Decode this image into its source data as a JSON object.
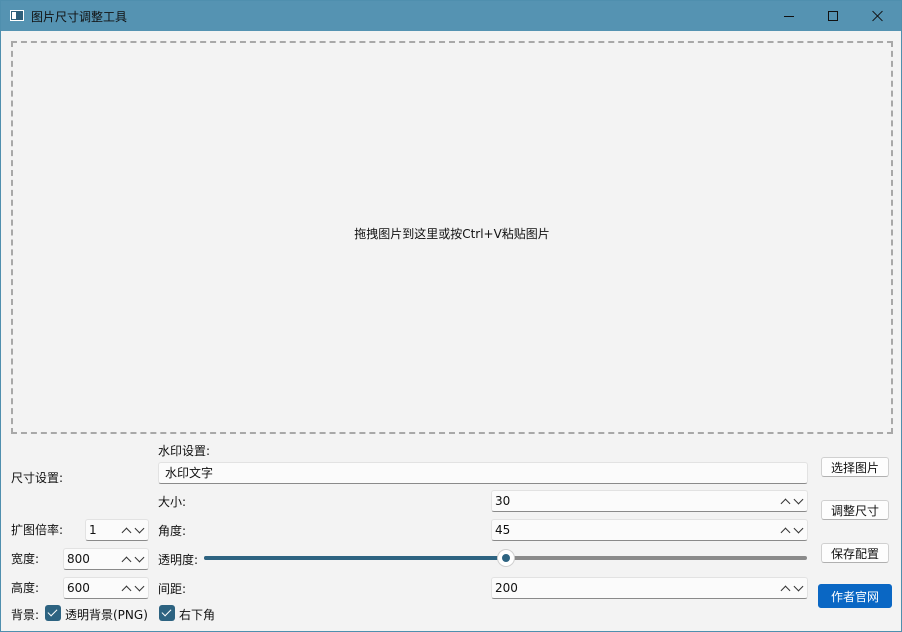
{
  "window": {
    "title": "图片尺寸调整工具"
  },
  "drop_zone": {
    "hint": "拖拽图片到这里或按Ctrl+V粘贴图片"
  },
  "size_settings": {
    "section_label": "尺寸设置:",
    "scale_label": "扩图倍率:",
    "scale_value": "1",
    "width_label": "宽度:",
    "width_value": "800",
    "height_label": "高度:",
    "height_value": "600",
    "background_label": "背景:",
    "transparent_bg_label": "透明背景(PNG)",
    "transparent_bg_checked": true,
    "bottom_right_label": "右下角",
    "bottom_right_checked": true
  },
  "watermark": {
    "section_label": "水印设置:",
    "text_value": "水印文字",
    "size_label": "大小:",
    "size_value": "30",
    "angle_label": "角度:",
    "angle_value": "45",
    "opacity_label": "透明度:",
    "opacity_fraction": 0.5,
    "spacing_label": "间距:",
    "spacing_value": "200"
  },
  "actions": {
    "select_image": "选择图片",
    "resize": "调整尺寸",
    "save_config": "保存配置",
    "author_site": "作者官网"
  },
  "colors": {
    "titlebar": "#5593b2",
    "accent": "#2d6381",
    "primary_button": "#0a67c4"
  }
}
